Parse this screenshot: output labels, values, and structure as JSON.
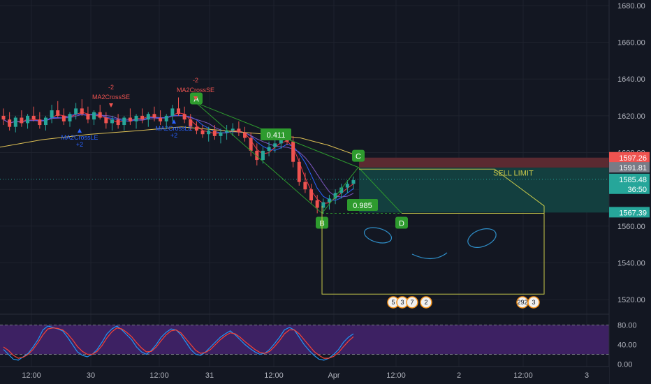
{
  "colors": {
    "background": "#131722",
    "grid": "#1e222d",
    "axis_text": "#b2b5be",
    "up": "#26a69a",
    "down": "#ef5350",
    "pattern_green": "#2e9b2e",
    "sell_box": "#c8c84a",
    "red_zone": "#5b2a31",
    "teal_zone": "#133f3f",
    "ma_yellow": "#e0c255",
    "ma_blue": "#2962ff",
    "ma_red": "#f23645",
    "stoch_blue": "#2196f3",
    "stoch_red": "#f44336",
    "stoch_band": "#3d2163",
    "drawing_blue": "#2f8fc9"
  },
  "chart_data": [
    {
      "type": "candlestick",
      "y_ticks": [
        "1680.00",
        "1660.00",
        "1640.00",
        "1620.00",
        "1600.00",
        "1580.00",
        "1560.00",
        "1540.00",
        "1520.00"
      ],
      "ylim": [
        1514,
        1683
      ],
      "x_ticks": [
        "12:00",
        "30",
        "12:00",
        "31",
        "12:00",
        "Apr",
        "12:00",
        "2",
        "12:00",
        "3"
      ],
      "candles": [
        [
          1620,
          1624,
          1615,
          1618
        ],
        [
          1618,
          1622,
          1612,
          1614
        ],
        [
          1614,
          1620,
          1611,
          1619
        ],
        [
          1619,
          1623,
          1614,
          1616
        ],
        [
          1616,
          1621,
          1613,
          1620
        ],
        [
          1620,
          1625,
          1617,
          1618
        ],
        [
          1618,
          1622,
          1613,
          1615
        ],
        [
          1615,
          1620,
          1612,
          1619
        ],
        [
          1619,
          1626,
          1616,
          1623
        ],
        [
          1623,
          1628,
          1619,
          1620
        ],
        [
          1620,
          1624,
          1615,
          1617
        ],
        [
          1617,
          1622,
          1614,
          1621
        ],
        [
          1621,
          1627,
          1618,
          1624
        ],
        [
          1624,
          1629,
          1620,
          1621
        ],
        [
          1621,
          1625,
          1616,
          1618
        ],
        [
          1618,
          1623,
          1615,
          1622
        ],
        [
          1622,
          1626,
          1618,
          1619
        ],
        [
          1619,
          1622,
          1613,
          1616
        ],
        [
          1616,
          1620,
          1612,
          1618
        ],
        [
          1618,
          1621,
          1613,
          1615
        ],
        [
          1615,
          1620,
          1612,
          1619
        ],
        [
          1619,
          1624,
          1615,
          1617
        ],
        [
          1617,
          1621,
          1613,
          1620
        ],
        [
          1620,
          1624,
          1616,
          1618
        ],
        [
          1618,
          1622,
          1614,
          1621
        ],
        [
          1621,
          1625,
          1617,
          1619
        ],
        [
          1619,
          1623,
          1615,
          1617
        ],
        [
          1617,
          1621,
          1613,
          1620
        ],
        [
          1620,
          1626,
          1617,
          1624
        ],
        [
          1624,
          1630,
          1620,
          1621
        ],
        [
          1621,
          1625,
          1616,
          1618
        ],
        [
          1618,
          1621,
          1612,
          1614
        ],
        [
          1614,
          1617,
          1610,
          1612
        ],
        [
          1612,
          1615,
          1608,
          1610
        ],
        [
          1610,
          1614,
          1606,
          1612
        ],
        [
          1612,
          1615,
          1607,
          1609
        ],
        [
          1609,
          1613,
          1605,
          1611
        ],
        [
          1611,
          1615,
          1607,
          1612
        ],
        [
          1612,
          1616,
          1609,
          1613
        ],
        [
          1613,
          1617,
          1609,
          1611
        ],
        [
          1611,
          1614,
          1606,
          1608
        ],
        [
          1608,
          1611,
          1598,
          1601
        ],
        [
          1601,
          1605,
          1593,
          1596
        ],
        [
          1596,
          1603,
          1594,
          1601
        ],
        [
          1601,
          1606,
          1598,
          1603
        ],
        [
          1603,
          1609,
          1600,
          1605
        ],
        [
          1605,
          1611,
          1602,
          1608
        ],
        [
          1608,
          1613,
          1604,
          1606
        ],
        [
          1606,
          1609,
          1592,
          1595
        ],
        [
          1595,
          1597,
          1582,
          1584
        ],
        [
          1584,
          1589,
          1578,
          1580
        ],
        [
          1580,
          1583,
          1572,
          1574
        ],
        [
          1574,
          1577,
          1567,
          1570
        ],
        [
          1570,
          1575,
          1567,
          1573
        ],
        [
          1573,
          1577,
          1569,
          1575
        ],
        [
          1575,
          1580,
          1572,
          1578
        ],
        [
          1578,
          1583,
          1575,
          1581
        ],
        [
          1581,
          1585,
          1578,
          1583
        ],
        [
          1583,
          1587,
          1580,
          1585
        ]
      ],
      "price_labels": [
        {
          "text": "1597.26",
          "value": 1597.26,
          "color": "#ef5350"
        },
        {
          "text": "1591.81",
          "value": 1591.81,
          "color": "#787b86"
        },
        {
          "text": "1585.48",
          "value": 1585.48,
          "color": "#26a69a"
        },
        {
          "text": "36:50",
          "value": 1581.0,
          "color": "#26a69a"
        },
        {
          "text": "1567.39",
          "value": 1567.39,
          "color": "#26a69a"
        }
      ],
      "pattern_points": [
        {
          "label": "A",
          "value": 1627
        },
        {
          "label": "B",
          "value": 1567
        },
        {
          "label": "C",
          "value": 1592
        },
        {
          "label": "D",
          "value": 1567
        }
      ],
      "ratios": [
        "0.411",
        "0.985"
      ],
      "sell_limit_label": "SELL LIMIT",
      "annotations": [
        {
          "text": "MA2CrossSE",
          "sign": "-2"
        },
        {
          "text": "MA2CrossSE",
          "sign": "-2"
        },
        {
          "text": "MA2CrossLE",
          "sign": "+2"
        },
        {
          "text": "MA2CrossLE",
          "sign": "+2"
        }
      ],
      "event_badges": [
        {
          "group": [
            "5",
            "3",
            "7",
            "2"
          ]
        },
        {
          "group": [
            "292",
            "3"
          ]
        }
      ]
    },
    {
      "type": "line",
      "name": "stochastic",
      "y_ticks": [
        "80.00",
        "40.00",
        "0.00"
      ],
      "ylim": [
        -5,
        95
      ],
      "band": [
        20,
        80
      ],
      "series": [
        {
          "color": "#2196f3",
          "values": [
            30,
            20,
            10,
            8,
            15,
            22,
            35,
            50,
            70,
            78,
            75,
            72,
            68,
            55,
            40,
            25,
            18,
            15,
            20,
            30,
            45,
            62,
            72,
            78,
            70,
            60,
            50,
            35,
            25,
            20,
            28,
            40,
            55,
            65,
            72,
            70,
            60,
            45,
            30,
            20,
            18,
            25,
            35,
            45,
            55,
            62,
            68,
            60,
            50,
            40,
            32,
            25,
            20,
            22,
            30,
            42,
            55,
            70,
            75,
            70,
            55,
            40,
            28,
            18,
            10,
            8,
            12,
            20,
            30,
            45,
            55,
            62
          ]
        },
        {
          "color": "#f44336",
          "values": [
            35,
            28,
            18,
            12,
            14,
            20,
            30,
            44,
            60,
            72,
            74,
            73,
            70,
            62,
            50,
            36,
            26,
            20,
            20,
            26,
            38,
            54,
            66,
            74,
            72,
            65,
            56,
            44,
            33,
            25,
            26,
            35,
            48,
            60,
            68,
            70,
            64,
            52,
            40,
            28,
            22,
            24,
            30,
            40,
            50,
            58,
            64,
            62,
            55,
            46,
            38,
            30,
            24,
            22,
            26,
            36,
            48,
            62,
            70,
            70,
            62,
            50,
            38,
            26,
            18,
            12,
            12,
            16,
            24,
            36,
            47,
            56
          ]
        }
      ]
    }
  ]
}
